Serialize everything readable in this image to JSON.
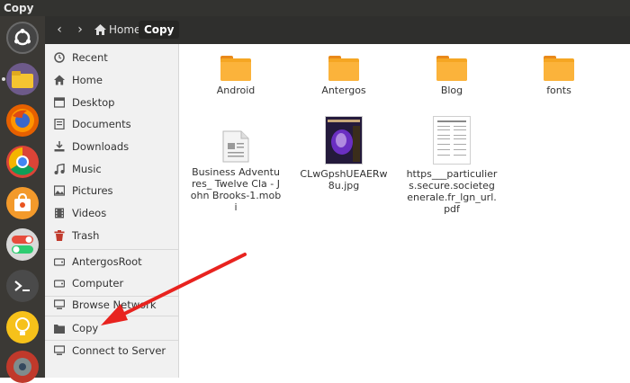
{
  "window": {
    "title": "Copy"
  },
  "toolbar": {
    "back": "‹",
    "forward": "›",
    "path": [
      "Home",
      "Copy"
    ]
  },
  "sidebar": {
    "items": [
      {
        "label": "Recent",
        "icon": "clock-icon"
      },
      {
        "label": "Home",
        "icon": "home-icon"
      },
      {
        "label": "Desktop",
        "icon": "desktop-icon"
      },
      {
        "label": "Documents",
        "icon": "documents-icon"
      },
      {
        "label": "Downloads",
        "icon": "download-icon"
      },
      {
        "label": "Music",
        "icon": "music-icon"
      },
      {
        "label": "Pictures",
        "icon": "pictures-icon"
      },
      {
        "label": "Videos",
        "icon": "videos-icon"
      },
      {
        "label": "Trash",
        "icon": "trash-icon"
      },
      {
        "label": "AntergosRoot",
        "icon": "drive-icon"
      },
      {
        "label": "Computer",
        "icon": "computer-icon"
      },
      {
        "label": "Browse Network",
        "icon": "network-icon"
      },
      {
        "label": "Copy",
        "icon": "folder-icon"
      },
      {
        "label": "Connect to Server",
        "icon": "server-icon"
      }
    ]
  },
  "files": [
    {
      "name": "Android",
      "type": "folder"
    },
    {
      "name": "Antergos",
      "type": "folder"
    },
    {
      "name": "Blog",
      "type": "folder"
    },
    {
      "name": "fonts",
      "type": "folder"
    },
    {
      "name": "Business Adventures_ Twelve Cla - John Brooks-1.mobi",
      "type": "document"
    },
    {
      "name": "CLwGpshUEAERw8u.jpg",
      "type": "image"
    },
    {
      "name": "https___particuliers.secure.societegenerale.fr_lgn_url.pdf",
      "type": "pdf"
    }
  ],
  "colors": {
    "accent_arrow": "#e8231f",
    "folder": "#f5a623"
  }
}
